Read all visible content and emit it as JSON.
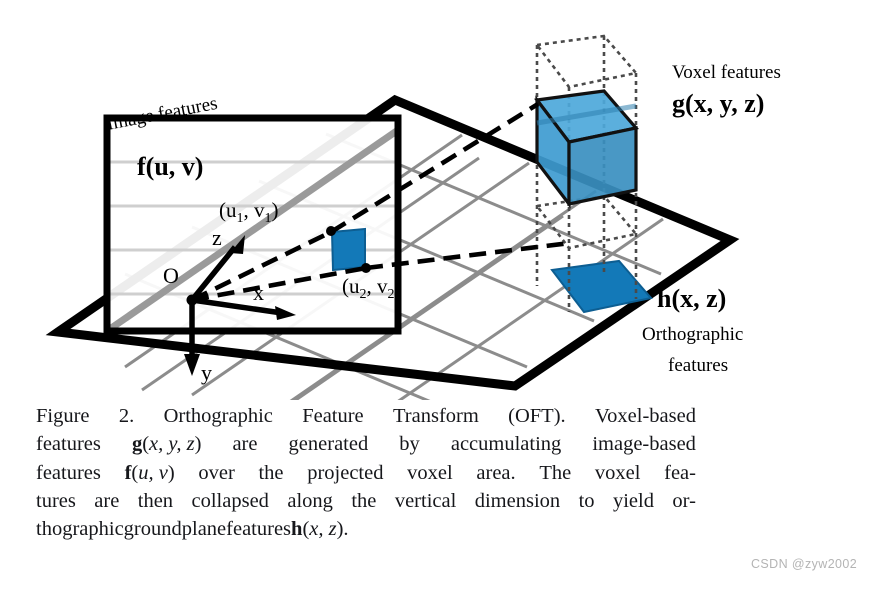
{
  "figure": {
    "title": "Orthographic Feature Transform (OFT) diagram",
    "labels": {
      "image_features": "Image features",
      "image_features_fn": "f(u, v)",
      "voxel_features": "Voxel features",
      "voxel_features_fn": "g(x, y, z)",
      "orthographic_fn": "h(x, z)",
      "orthographic_line1": "Orthographic",
      "orthographic_line2": "features",
      "axis_x": "x",
      "axis_y": "y",
      "axis_z": "z",
      "origin": "O",
      "coord1_open": "(u",
      "coord1_sub1": "1",
      "coord1_mid": ", v",
      "coord1_sub2": "1",
      "coord1_close": ")",
      "coord2_open": "(u",
      "coord2_sub1": "2",
      "coord2_mid": ", v",
      "coord2_sub2": "2",
      "coord2_close": ")"
    },
    "colors": {
      "voxel_top": "#4DA8DA",
      "voxel_front": "#3E9BD0",
      "voxel_side": "#3A8FC0",
      "voxel_edge": "#111111",
      "ground_cell": "#1379B8",
      "image_patch": "#1379B8",
      "plane_outline": "#000000",
      "grid_line": "#8C8C8C",
      "grid_line_light": "#C8C8C8",
      "dotted_column": "#555555",
      "background": "#FFFFFF"
    }
  },
  "caption": {
    "lines": [
      {
        "id": "line1",
        "segments": [
          {
            "text": "Figure 2. Orthographic Feature Transform (OFT). Voxel-based",
            "style": "normal"
          }
        ]
      },
      {
        "id": "line2",
        "segments": [
          {
            "text": "features ",
            "style": "normal"
          },
          {
            "text": "g",
            "style": "bold"
          },
          {
            "text": "(",
            "style": "normal"
          },
          {
            "text": "x, y, z",
            "style": "italic"
          },
          {
            "text": ") are generated by accumulating image-based",
            "style": "normal"
          }
        ]
      },
      {
        "id": "line3",
        "segments": [
          {
            "text": "features ",
            "style": "normal"
          },
          {
            "text": "f",
            "style": "bold"
          },
          {
            "text": "(",
            "style": "normal"
          },
          {
            "text": "u, v",
            "style": "italic"
          },
          {
            "text": ") over the projected voxel area.  The voxel fea-",
            "style": "normal"
          }
        ]
      },
      {
        "id": "line4",
        "segments": [
          {
            "text": "tures are then collapsed along the vertical dimension to yield or-",
            "style": "normal"
          }
        ]
      },
      {
        "id": "line5",
        "segments": [
          {
            "text": "thographic ground plane features ",
            "style": "normal"
          },
          {
            "text": "h",
            "style": "bold"
          },
          {
            "text": "(",
            "style": "normal"
          },
          {
            "text": "x, z",
            "style": "italic"
          },
          {
            "text": ").",
            "style": "normal"
          }
        ]
      }
    ],
    "full_text": "Figure 2. Orthographic Feature Transform (OFT). Voxel-based features g(x, y, z) are generated by accumulating image-based features f(u, v) over the projected voxel area. The voxel features are then collapsed along the vertical dimension to yield orthographic ground plane features h(x, z)."
  },
  "watermark": {
    "text": "CSDN @zyw2002"
  }
}
